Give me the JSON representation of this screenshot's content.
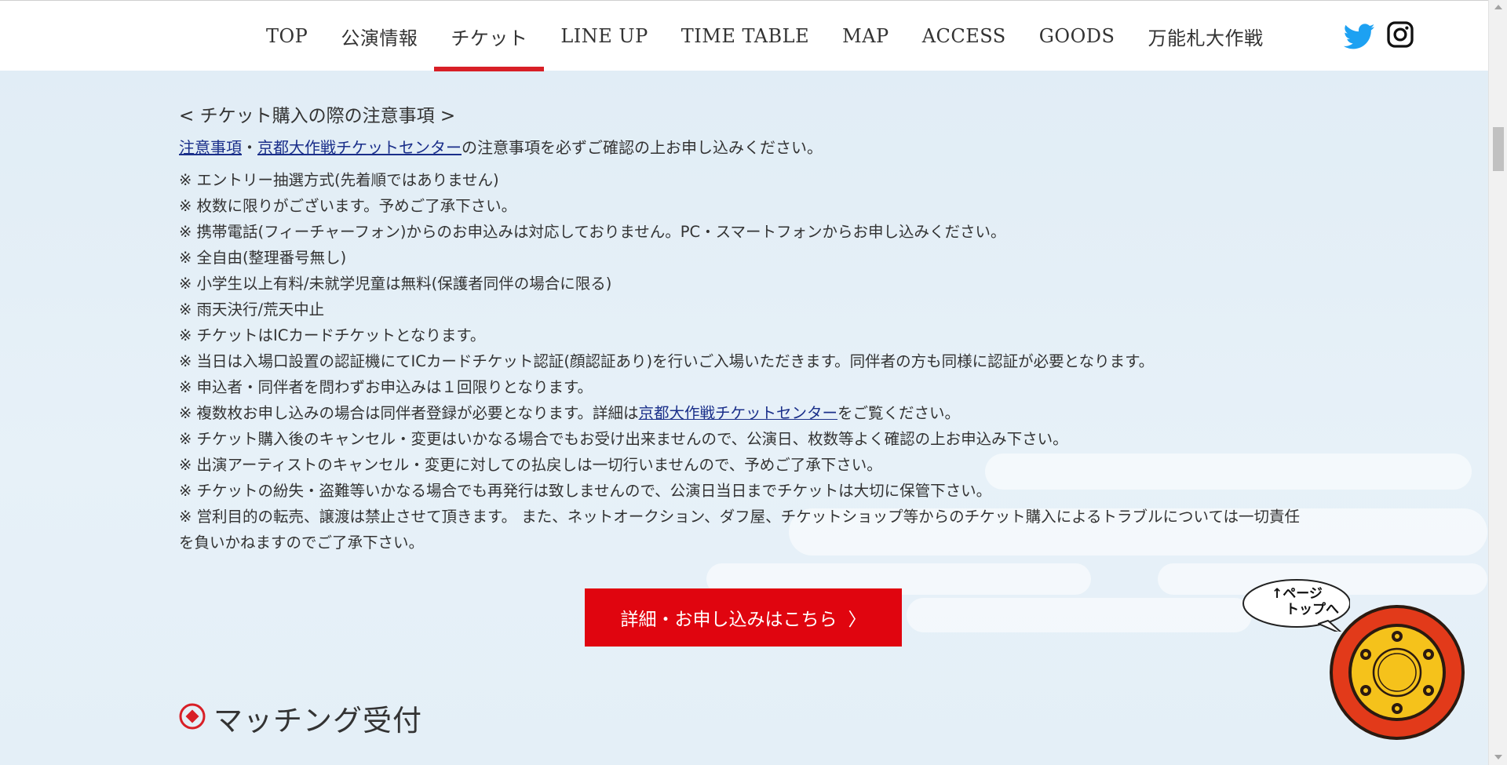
{
  "nav": {
    "items": [
      {
        "label": "TOP",
        "active": false
      },
      {
        "label": "公演情報",
        "active": false
      },
      {
        "label": "チケット",
        "active": true
      },
      {
        "label": "LINE UP",
        "active": false
      },
      {
        "label": "TIME TABLE",
        "active": false
      },
      {
        "label": "MAP",
        "active": false
      },
      {
        "label": "ACCESS",
        "active": false
      },
      {
        "label": "GOODS",
        "active": false
      },
      {
        "label": "万能札大作戦",
        "active": false
      }
    ],
    "social_icons": [
      "twitter-icon",
      "instagram-icon"
    ],
    "active_color": "#d81f26"
  },
  "notes": {
    "title": "< チケット購入の際の注意事項 >",
    "intro": {
      "link1": "注意事項",
      "separator": "・",
      "link2": "京都大作戦チケットセンター",
      "text": "の注意事項を必ずご確認の上お申し込みください。"
    },
    "items": [
      "※ エントリー抽選方式(先着順ではありません)",
      "※ 枚数に限りがございます。予めご了承下さい。",
      "※ 携帯電話(フィーチャーフォン)からのお申込みは対応しておりません。PC・スマートフォンからお申し込みください。",
      "※ 全自由(整理番号無し)",
      "※ 小学生以上有料/未就学児童は無料(保護者同伴の場合に限る)",
      "※ 雨天決行/荒天中止",
      "※ チケットはICカードチケットとなります。",
      "※ 当日は入場口設置の認証機にてICカードチケット認証(顔認証あり)を行いご入場いただきます。同伴者の方も同様に認証が必要となります。",
      "※ 申込者・同伴者を問わずお申込みは１回限りとなります。"
    ],
    "item_link": {
      "before": "※ 複数枚お申し込みの場合は同伴者登録が必要となります。詳細は",
      "link": "京都大作戦チケットセンター",
      "after": "をご覧ください。"
    },
    "items2": [
      "※ チケット購入後のキャンセル・変更はいかなる場合でもお受け出来ませんので、公演日、枚数等よく確認の上お申込み下さい。",
      "※ 出演アーティストのキャンセル・変更に対しての払戻しは一切行いませんので、予めご了承下さい。",
      "※ チケットの紛失・盗難等いかなる場合でも再発行は致しませんので、公演日当日までチケットは大切に保管下さい。",
      "※ 営利目的の転売、譲渡は禁止させて頂きます。 また、ネットオークション、ダフ屋、チケットショップ等からのチケット購入によるトラブルについては一切責任を負いかねますのでご了承下さい。"
    ]
  },
  "cta": {
    "label": "詳細・お申し込みはこちら",
    "arrow": "〉",
    "color": "#e0050f"
  },
  "section": {
    "heading": "マッチング受付",
    "marker_color": "#d81f26"
  },
  "pagetop": {
    "line1": "↑ページ",
    "line2": "トップへ"
  }
}
